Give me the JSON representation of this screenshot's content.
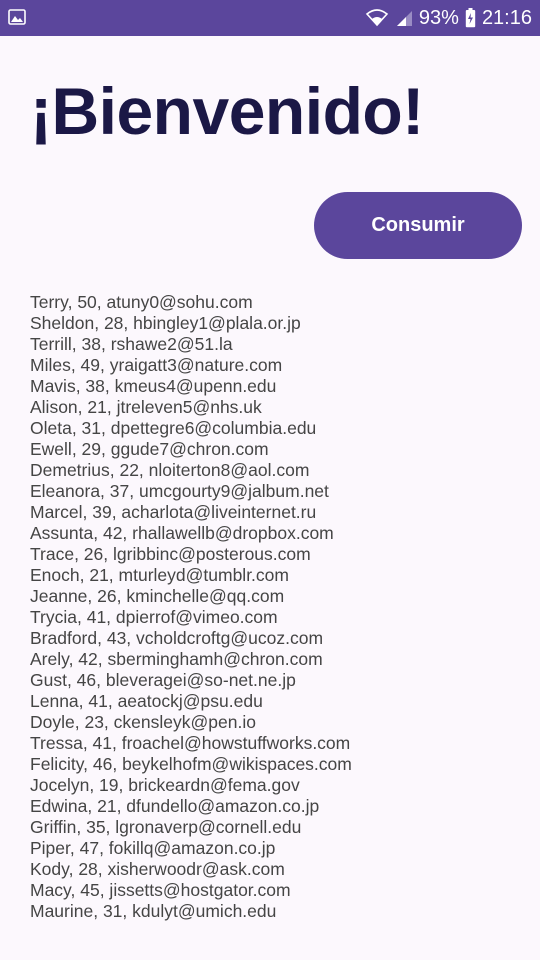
{
  "status_bar": {
    "battery_percent": "93%",
    "time": "21:16",
    "icons": [
      "image-icon",
      "wifi-icon",
      "signal-icon",
      "battery-charging-icon"
    ]
  },
  "title": "¡Bienvenido!",
  "consume_button_label": "Consumir",
  "people": [
    "Terry, 50, atuny0@sohu.com",
    "Sheldon, 28, hbingley1@plala.or.jp",
    "Terrill, 38, rshawe2@51.la",
    "Miles, 49, yraigatt3@nature.com",
    "Mavis, 38, kmeus4@upenn.edu",
    "Alison, 21, jtreleven5@nhs.uk",
    "Oleta, 31, dpettegre6@columbia.edu",
    "Ewell, 29, ggude7@chron.com",
    "Demetrius, 22, nloiterton8@aol.com",
    "Eleanora, 37, umcgourty9@jalbum.net",
    "Marcel, 39, acharlota@liveinternet.ru",
    "Assunta, 42, rhallawellb@dropbox.com",
    "Trace, 26, lgribbinc@posterous.com",
    "Enoch, 21, mturleyd@tumblr.com",
    "Jeanne, 26, kminchelle@qq.com",
    "Trycia, 41, dpierrof@vimeo.com",
    "Bradford, 43, vcholdcroftg@ucoz.com",
    "Arely, 42, sberminghamh@chron.com",
    "Gust, 46, bleveragei@so-net.ne.jp",
    "Lenna, 41, aeatockj@psu.edu",
    "Doyle, 23, ckensleyk@pen.io",
    "Tressa, 41, froachel@howstuffworks.com",
    "Felicity, 46, beykelhofm@wikispaces.com",
    "Jocelyn, 19, brickeardn@fema.gov",
    "Edwina, 21, dfundello@amazon.co.jp",
    "Griffin, 35, lgronaverp@cornell.edu",
    "Piper, 47, fokillq@amazon.co.jp",
    "Kody, 28, xisherwoodr@ask.com",
    "Macy, 45, jissetts@hostgator.com",
    "Maurine, 31, kdulyt@umich.edu"
  ],
  "colors": {
    "status_bar": "#5b469c",
    "button": "#5b469c",
    "title": "#1b1846",
    "list_text": "#454545",
    "background": "#fcf8fd"
  }
}
